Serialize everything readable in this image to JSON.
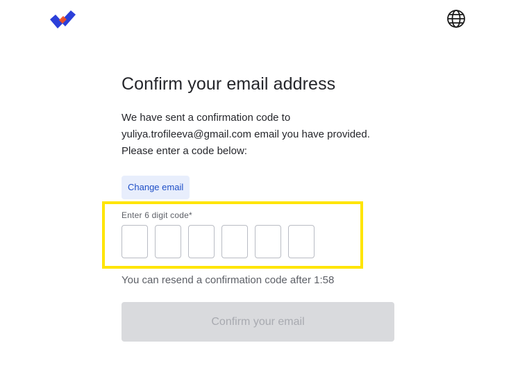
{
  "header": {
    "logo_icon": "checkmark-logo",
    "language_icon": "globe-icon"
  },
  "main": {
    "title": "Confirm your email address",
    "description_line1": "We have sent a confirmation code to",
    "description_line2": "yuliya.trofileeva@gmail.com email you have provided.",
    "description_line3": "Please enter a code below:",
    "change_email_label": "Change email",
    "code_label": "Enter 6 digit code*",
    "code_digits": [
      "",
      "",
      "",
      "",
      "",
      ""
    ],
    "resend_text": "You can resend a confirmation code after 1:58",
    "confirm_label": "Confirm your email"
  },
  "colors": {
    "highlight": "#ffe500",
    "accent": "#1f4fc7",
    "button_disabled_bg": "#d9dadd",
    "logo_blue": "#2b3fd9",
    "logo_red": "#f25022"
  }
}
